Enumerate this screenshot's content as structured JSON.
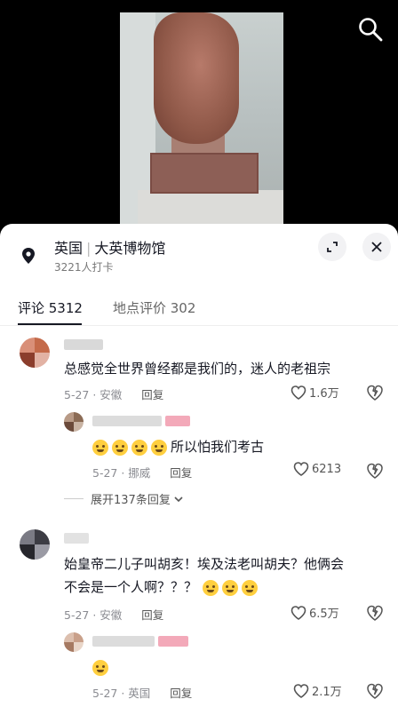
{
  "location": {
    "country": "英国",
    "name": "大英博物馆",
    "checkins": "3221人打卡"
  },
  "tabs": [
    {
      "label": "评论 5312"
    },
    {
      "label": "地点评价 302"
    }
  ],
  "comments": [
    {
      "text": "总感觉全世界曾经都是我们的，迷人的老祖宗",
      "meta": "5-27 · 安徽",
      "reply": "回复",
      "likes": "1.6万"
    },
    {
      "text": "所以怕我们考古",
      "meta": "5-27 · 挪威",
      "reply": "回复",
      "likes": "6213"
    },
    {
      "text_line1": "始皇帝二儿子叫胡亥！埃及法老叫胡夫？他俩会",
      "text_line2": "不会是一个人啊？？？",
      "meta": "5-27 · 安徽",
      "reply": "回复",
      "likes": "6.5万"
    },
    {
      "meta": "5-27 · 英国",
      "reply": "回复",
      "likes": "2.1万"
    }
  ],
  "expand_replies": "展开137条回复",
  "icons": [
    "search-icon",
    "location-pin-icon",
    "collapse-icon",
    "close-icon",
    "heart-icon",
    "dislike-icon",
    "crying-emoji-icon",
    "chevron-down-icon"
  ]
}
